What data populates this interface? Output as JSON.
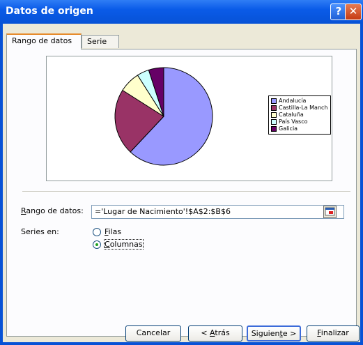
{
  "window": {
    "title": "Datos de origen",
    "help_label": "?",
    "close_label": "✕",
    "title_bar_color": "#0a5be8"
  },
  "tabs": [
    {
      "label": "Rango de datos",
      "active": true
    },
    {
      "label": "Serie",
      "active": false
    }
  ],
  "chart_data": {
    "type": "pie",
    "title": "",
    "legend_position": "right",
    "slices": [
      {
        "label": "Andalucía",
        "value": 62,
        "color": "#9999ff"
      },
      {
        "label": "Castilla-La Mancha",
        "value": 22,
        "color": "#993366"
      },
      {
        "label": "Cataluña",
        "value": 7,
        "color": "#ffffcc"
      },
      {
        "label": "País Vasco",
        "value": 4,
        "color": "#ccffff"
      },
      {
        "label": "Galicia",
        "value": 5,
        "color": "#660066"
      }
    ],
    "legend_labels": [
      "Andalucía",
      "Castilla-La Mancha",
      "Cataluña",
      "País Vasco",
      "Galicia"
    ]
  },
  "form": {
    "range_label_underlined": "R",
    "range_label_rest": "ango de datos:",
    "range_value": "='Lugar de Nacimiento'!$A$2:$B$6",
    "series_label": "Series en:",
    "rows_label_underlined": "F",
    "rows_label_rest": "ilas",
    "columns_label_underlined": "C",
    "columns_label_rest": "olumnas",
    "series_in": "columns"
  },
  "buttons": {
    "cancel": "Cancelar",
    "back_prefix": "< ",
    "back_underlined": "A",
    "back_rest": "trás",
    "next_prefix": "Siguien",
    "next_underlined": "t",
    "next_rest": "e >",
    "finish_underlined": "F",
    "finish_rest": "inalizar"
  }
}
